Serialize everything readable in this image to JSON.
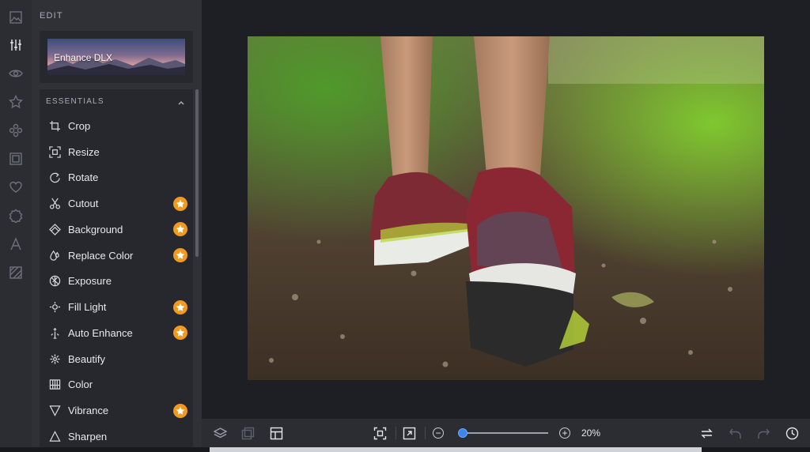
{
  "rail": {
    "items": [
      {
        "icon": "image-icon"
      },
      {
        "icon": "sliders-icon",
        "active": true
      },
      {
        "icon": "eye-icon"
      },
      {
        "icon": "star-icon"
      },
      {
        "icon": "effects-icon"
      },
      {
        "icon": "frame-icon"
      },
      {
        "icon": "heart-icon"
      },
      {
        "icon": "badge-icon"
      },
      {
        "icon": "text-icon"
      },
      {
        "icon": "texture-icon"
      }
    ]
  },
  "panel": {
    "title": "EDIT",
    "enhance_card_label": "Enhance DLX",
    "section_title": "ESSENTIALS",
    "tools": [
      {
        "label": "Crop",
        "icon": "crop-icon",
        "premium": false
      },
      {
        "label": "Resize",
        "icon": "resize-icon",
        "premium": false
      },
      {
        "label": "Rotate",
        "icon": "rotate-icon",
        "premium": false
      },
      {
        "label": "Cutout",
        "icon": "scissors-icon",
        "premium": true
      },
      {
        "label": "Background",
        "icon": "background-icon",
        "premium": true
      },
      {
        "label": "Replace Color",
        "icon": "drop-icon",
        "premium": true
      },
      {
        "label": "Exposure",
        "icon": "exposure-icon",
        "premium": false
      },
      {
        "label": "Fill Light",
        "icon": "sun-icon",
        "premium": true
      },
      {
        "label": "Auto Enhance",
        "icon": "wand-icon",
        "premium": true
      },
      {
        "label": "Beautify",
        "icon": "beautify-icon",
        "premium": false
      },
      {
        "label": "Color",
        "icon": "color-icon",
        "premium": false
      },
      {
        "label": "Vibrance",
        "icon": "vibrance-icon",
        "premium": true
      },
      {
        "label": "Sharpen",
        "icon": "sharpen-icon",
        "premium": false
      }
    ]
  },
  "toolbar": {
    "zoom_value": "20%",
    "zoom_level": 0.2
  },
  "colors": {
    "accent": "#3c86f0",
    "premium": "#f29a1f"
  }
}
